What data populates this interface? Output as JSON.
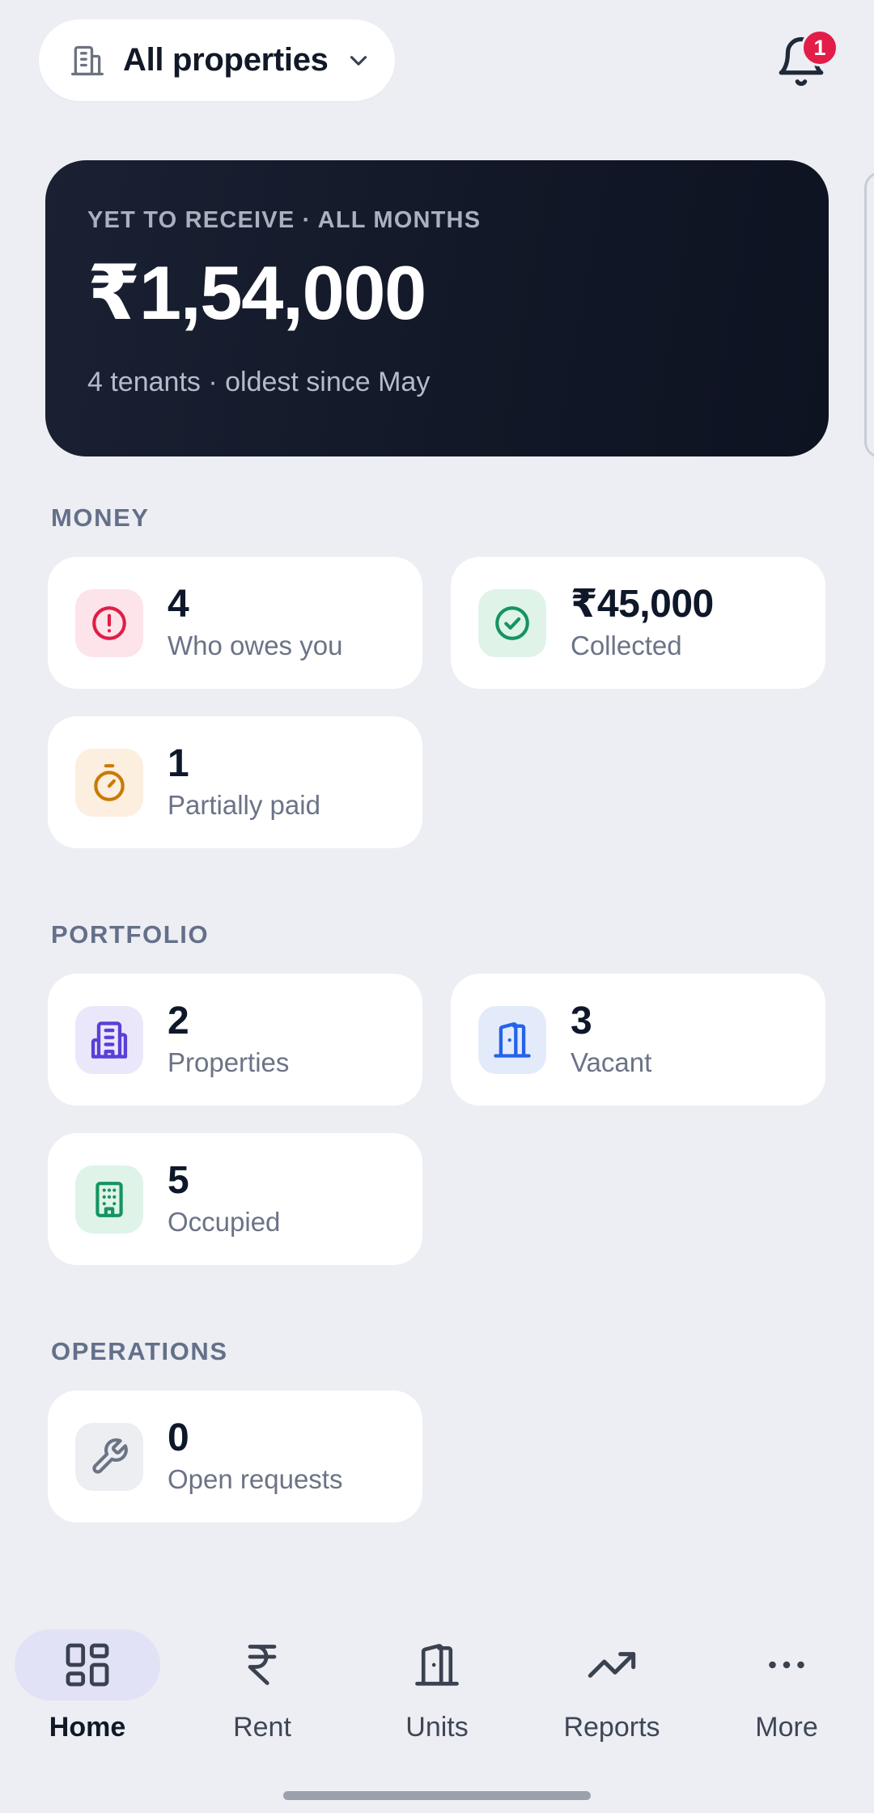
{
  "header": {
    "property_selector": {
      "label": "All properties",
      "icon": "building-icon",
      "chevron": "chevron-down-icon"
    },
    "notifications": {
      "icon": "bell-icon",
      "badge_count": "1"
    }
  },
  "hero": {
    "kicker": "YET TO RECEIVE · ALL MONTHS",
    "amount": "₹1,54,000",
    "subtitle": "4 tenants · oldest since May"
  },
  "sections": {
    "money": {
      "title": "MONEY",
      "cards": [
        {
          "value": "4",
          "caption": "Who owes you",
          "icon": "alert-circle-icon",
          "color": "#e11d48",
          "tile": "#fde4ea"
        },
        {
          "value": "₹45,000",
          "caption": "Collected",
          "icon": "check-circle-icon",
          "color": "#15945f",
          "tile": "#dff3e9"
        },
        {
          "value": "1",
          "caption": "Partially paid",
          "icon": "timer-icon",
          "color": "#c97a06",
          "tile": "#fcefdf"
        }
      ]
    },
    "portfolio": {
      "title": "PORTFOLIO",
      "cards": [
        {
          "value": "2",
          "caption": "Properties",
          "icon": "building-icon",
          "color": "#5b3fd6",
          "tile": "#ebe7fb"
        },
        {
          "value": "3",
          "caption": "Vacant",
          "icon": "door-icon",
          "color": "#2563eb",
          "tile": "#e3ebfb"
        },
        {
          "value": "5",
          "caption": "Occupied",
          "icon": "apartment-icon",
          "color": "#15945f",
          "tile": "#dff3e9"
        }
      ]
    },
    "operations": {
      "title": "OPERATIONS",
      "cards": [
        {
          "value": "0",
          "caption": "Open requests",
          "icon": "wrench-icon",
          "color": "#6b7386",
          "tile": "#eceef2"
        }
      ]
    }
  },
  "bottom_nav": {
    "items": [
      {
        "label": "Home",
        "icon": "dashboard-icon",
        "active": true
      },
      {
        "label": "Rent",
        "icon": "rupee-icon",
        "active": false
      },
      {
        "label": "Units",
        "icon": "door-icon",
        "active": false
      },
      {
        "label": "Reports",
        "icon": "trending-up-icon",
        "active": false
      },
      {
        "label": "More",
        "icon": "more-horizontal-icon",
        "active": false
      }
    ]
  }
}
